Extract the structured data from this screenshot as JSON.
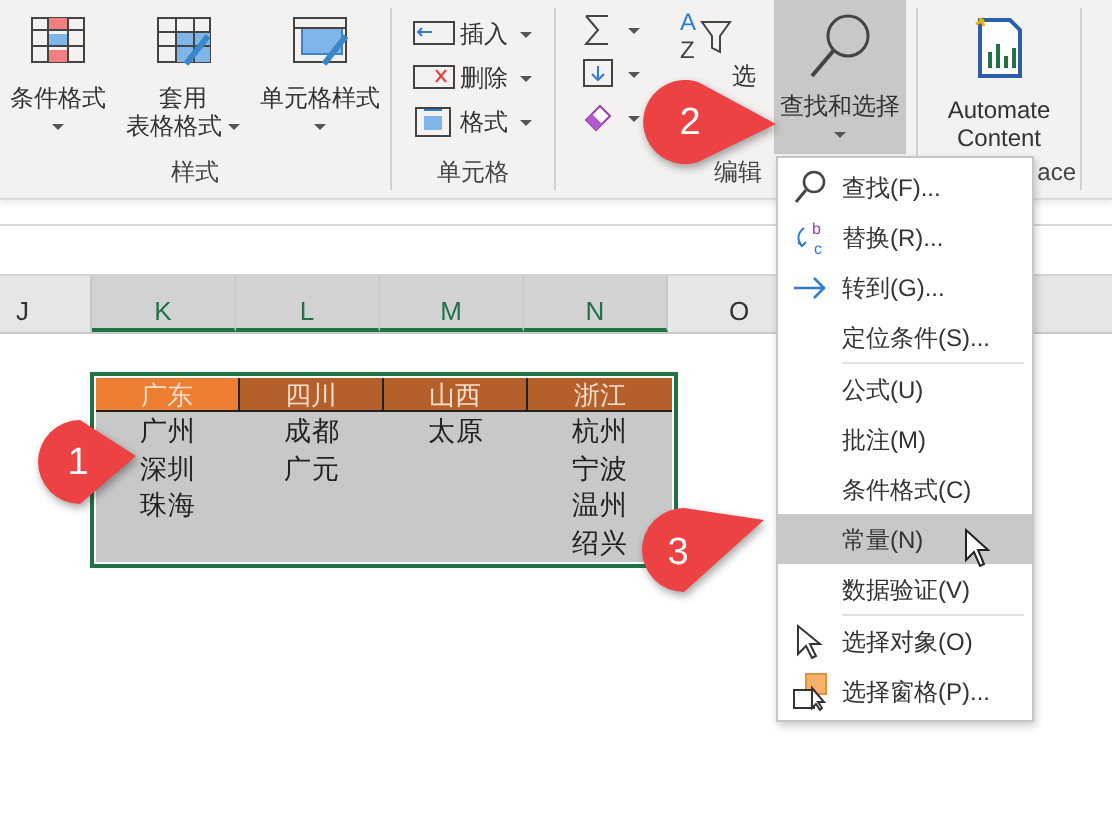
{
  "ribbon": {
    "groups": [
      {
        "kind": "large",
        "label": "样式",
        "buttons": [
          {
            "lines": [
              "条件格式"
            ]
          },
          {
            "lines": [
              "套用",
              "表格格式"
            ]
          },
          {
            "lines": [
              "单元格样式"
            ]
          }
        ]
      },
      {
        "kind": "small",
        "label": "单元格",
        "buttons": [
          {
            "label": "插入"
          },
          {
            "label": "删除"
          },
          {
            "label": "格式"
          }
        ]
      },
      {
        "kind": "editing",
        "label": "编辑",
        "sort": {
          "label": "选",
          "icon_letters": [
            "A",
            "Z"
          ]
        },
        "find": {
          "label": "查找和选择",
          "pressed": true
        }
      },
      {
        "kind": "large",
        "label": "ace",
        "buttons": [
          {
            "lines": [
              "Automate",
              "Content"
            ]
          }
        ]
      }
    ]
  },
  "columns": [
    {
      "label": "J",
      "selected": false
    },
    {
      "label": "K",
      "selected": true
    },
    {
      "label": "L",
      "selected": true
    },
    {
      "label": "M",
      "selected": true
    },
    {
      "label": "N",
      "selected": true
    },
    {
      "label": "O",
      "selected": false
    }
  ],
  "table": {
    "headers": [
      {
        "label": "广东",
        "color": "#ed7d31"
      },
      {
        "label": "四川",
        "color": "#b5602a"
      },
      {
        "label": "山西",
        "color": "#b5602a"
      },
      {
        "label": "浙江",
        "color": "#b5602a"
      }
    ],
    "columns": [
      [
        "广州",
        "深圳",
        "珠海"
      ],
      [
        "成都",
        "广元"
      ],
      [
        "太原"
      ],
      [
        "杭州",
        "宁波",
        "温州",
        "绍兴"
      ]
    ]
  },
  "menu": {
    "groups": [
      [
        {
          "label": "查找(F)...",
          "selected": false
        },
        {
          "label": "替换(R)...",
          "selected": false,
          "icon_letters": [
            "b",
            "c"
          ]
        },
        {
          "label": "转到(G)...",
          "selected": false
        },
        {
          "label": "定位条件(S)...",
          "selected": false
        }
      ],
      [
        {
          "label": "公式(U)",
          "selected": false
        },
        {
          "label": "批注(M)",
          "selected": false
        },
        {
          "label": "条件格式(C)",
          "selected": false
        },
        {
          "label": "常量(N)",
          "selected": true
        },
        {
          "label": "数据验证(V)",
          "selected": false
        }
      ],
      [
        {
          "label": "选择对象(O)",
          "selected": false
        },
        {
          "label": "选择窗格(P)...",
          "selected": false
        }
      ]
    ]
  },
  "callouts": [
    {
      "number": "1"
    },
    {
      "number": "2"
    },
    {
      "number": "3"
    }
  ]
}
